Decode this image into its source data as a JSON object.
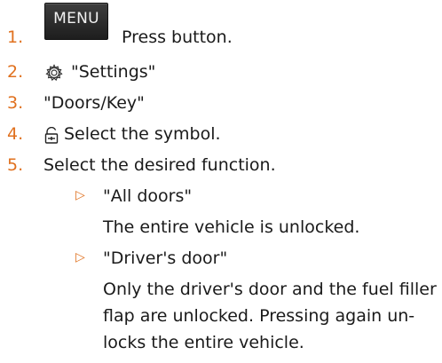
{
  "accent_color": "#e0711f",
  "steps": [
    {
      "num": "1.",
      "button_label": "MENU",
      "text": "Press button."
    },
    {
      "num": "2.",
      "icon": "gear-icon",
      "text": "\"Settings\""
    },
    {
      "num": "3.",
      "text": "\"Doors/Key\""
    },
    {
      "num": "4.",
      "icon": "unlock-symbol-icon",
      "text": "Select the symbol."
    },
    {
      "num": "5.",
      "text": "Select the desired function."
    }
  ],
  "options": [
    {
      "bullet": "▷",
      "label": "\"All doors\"",
      "description": [
        "The entire vehicle is unlocked."
      ]
    },
    {
      "bullet": "▷",
      "label": "\"Driver's door\"",
      "description": [
        "Only the driver's door and the fuel filler",
        "flap are unlocked. Pressing again un-",
        "locks the entire vehicle."
      ]
    }
  ]
}
